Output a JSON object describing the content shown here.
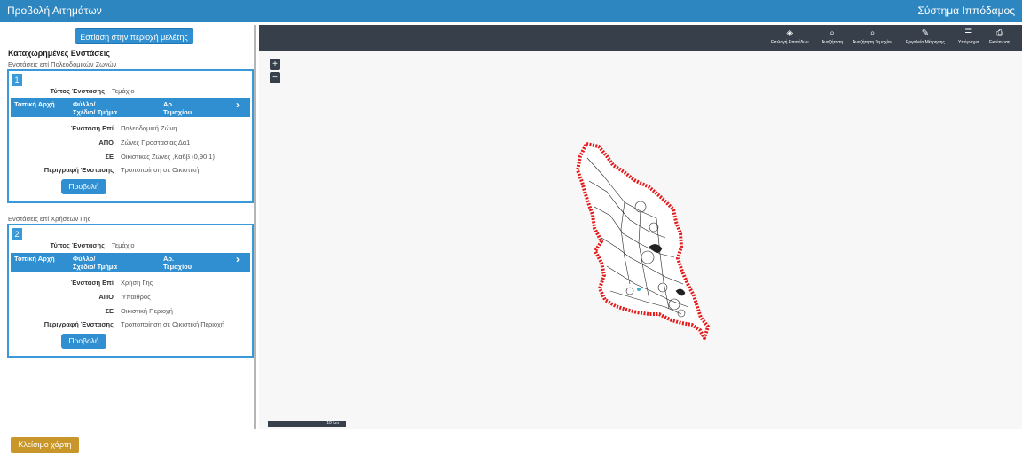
{
  "header": {
    "app_title": "Προβολή Αιτημάτων",
    "system_title": "Σύστημα Ιππόδαμος"
  },
  "left_panel": {
    "focus_button": "Εστίαση στην περιοχή μελέτης",
    "registered_title": "Καταχωρημένες Ενστάσεις",
    "sections": [
      {
        "title": "Ενστάσεις επί Πολεοδομικών Ζωνών",
        "number": "1",
        "type_label": "Τύπος Ένστασης",
        "type_value": "Τεμάχιο",
        "table_headers": [
          "Τοπική Αρχή",
          "Φύλλο/Σχέδιο/ Τμήμα",
          "Αρ. Τεμαχίου"
        ],
        "rows": [
          {
            "label": "Ένσταση Επί",
            "value": "Πολεοδομική Ζώνη"
          },
          {
            "label": "ΑΠΟ",
            "value": "Ζώνες Προστασίας Δα1"
          },
          {
            "label": "ΣΕ",
            "value": "Οικιστικές Ζώνες ,Κα6β (0,90:1)"
          },
          {
            "label": "Περιγραφή Ένστασης",
            "value": "Τροποποίηση σε Οικιστική"
          }
        ],
        "view_button": "Προβολή"
      },
      {
        "title": "Ενστάσεις επί Χρήσεων Γης",
        "number": "2",
        "type_label": "Τύπος Ένστασης",
        "type_value": "Τεμάχιο",
        "table_headers": [
          "Τοπική Αρχή",
          "Φύλλο/Σχέδιο/ Τμήμα",
          "Αρ. Τεμαχίου"
        ],
        "rows": [
          {
            "label": "Ένσταση Επί",
            "value": "Χρήση Γης"
          },
          {
            "label": "ΑΠΟ",
            "value": "Ύπαιθρος"
          },
          {
            "label": "ΣΕ",
            "value": "Οικιστική Περιοχή"
          },
          {
            "label": "Περιγραφή Ένστασης",
            "value": "Τροποποίηση σε Οικιστική Περιοχή"
          }
        ],
        "view_button": "Προβολή"
      }
    ]
  },
  "map": {
    "toolbar": [
      {
        "label": "Επιλογή Επιπέδων",
        "icon": "layers-icon",
        "glyph": "◈"
      },
      {
        "label": "Αναζήτηση",
        "icon": "search-icon",
        "glyph": "⌕"
      },
      {
        "label": "Αναζήτηση Τεμαχίου",
        "icon": "search-icon",
        "glyph": "⌕"
      },
      {
        "label": "Εργαλείο Μέτρησης",
        "icon": "ruler-icon",
        "glyph": "✎"
      },
      {
        "label": "Υπόμνημα",
        "icon": "legend-icon",
        "glyph": "☰"
      },
      {
        "label": "Εκτύπωση",
        "icon": "print-icon",
        "glyph": "⎙"
      }
    ],
    "zoom_in": "+",
    "zoom_out": "−",
    "scale_label": "10 km",
    "boundary_color": "#e31a1c"
  },
  "footer": {
    "close_map_button": "Κλείσιμο χάρτη"
  }
}
